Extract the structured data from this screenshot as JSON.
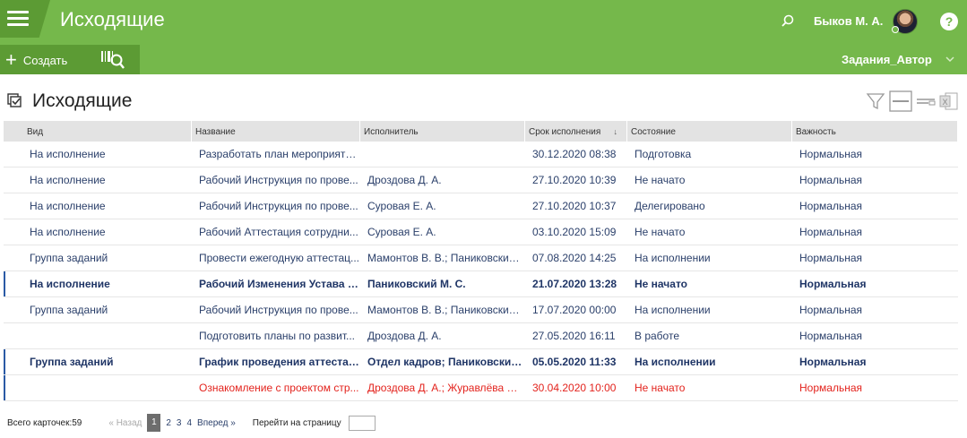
{
  "header": {
    "title": "Исходящие",
    "user": "Быков М. А."
  },
  "toolbar": {
    "create_label": "Создать",
    "filter": "Задания_Автор"
  },
  "page": {
    "title": "Исходящие"
  },
  "table": {
    "columns": [
      "Вид",
      "Название",
      "Исполнитель",
      "Срок исполнения",
      "Состояние",
      "Важность"
    ],
    "rows": [
      {
        "kind": "На исполнение",
        "name": "Разработать план мероприяти...",
        "executor": "",
        "due": "30.12.2020 08:38",
        "state": "Подготовка",
        "importance": "Нормальная"
      },
      {
        "kind": "На исполнение",
        "name": "Рабочий Инструкция по прове...",
        "executor": "Дроздова Д. А.",
        "due": "27.10.2020 10:39",
        "state": "Не начато",
        "importance": "Нормальная"
      },
      {
        "kind": "На исполнение",
        "name": "Рабочий Инструкция по прове...",
        "executor": "Суровая Е. А.",
        "due": "27.10.2020 10:37",
        "state": "Делегировано",
        "importance": "Нормальная"
      },
      {
        "kind": "На исполнение",
        "name": "Рабочий Аттестация сотрудни...",
        "executor": "Суровая Е. А.",
        "due": "03.10.2020 15:09",
        "state": "Не начато",
        "importance": "Нормальная"
      },
      {
        "kind": "Группа заданий",
        "name": "Провести ежегодную аттестац...",
        "executor": "Мамонтов В. В.; Паниковский ...",
        "due": "07.08.2020 14:25",
        "state": "На исполнении",
        "importance": "Нормальная"
      },
      {
        "kind": "На исполнение",
        "name": "Рабочий Изменения Устава ор...",
        "executor": "Паниковский М. С.",
        "due": "21.07.2020 13:28",
        "state": "Не начато",
        "importance": "Нормальная"
      },
      {
        "kind": "Группа заданий",
        "name": "Рабочий Инструкция по прове...",
        "executor": "Мамонтов В. В.; Паниковский ...",
        "due": "17.07.2020 00:00",
        "state": "На исполнении",
        "importance": "Нормальная"
      },
      {
        "kind": "",
        "name": "Подготовить планы по развит...",
        "executor": "Дроздова Д. А.",
        "due": "27.05.2020 16:11",
        "state": "В работе",
        "importance": "Нормальная"
      },
      {
        "kind": "Группа заданий",
        "name": "График проведения аттестаци...",
        "executor": "Отдел кадров; Паниковский ...",
        "due": "05.05.2020 11:33",
        "state": "На исполнении",
        "importance": "Нормальная"
      },
      {
        "kind": "",
        "name": "Ознакомление с проектом стр...",
        "executor": "Дроздова Д. А.; Журавлёва И. ...",
        "due": "30.04.2020 10:00",
        "state": "Не начато",
        "importance": "Нормальная"
      }
    ]
  },
  "footer": {
    "total": "Всего карточек:59",
    "prev": "« Назад",
    "pages": [
      "1",
      "2",
      "3",
      "4"
    ],
    "next": "Вперед »",
    "goto": "Перейти на страницу"
  },
  "colors": {
    "brand": "#75b84b",
    "brand_dark": "#5c9b34",
    "overdue": "#e3231d"
  }
}
